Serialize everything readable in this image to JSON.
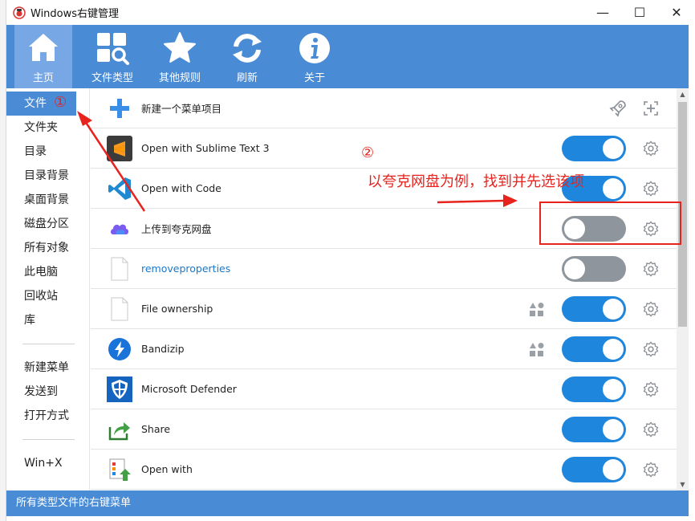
{
  "window": {
    "title": "Windows右键管理",
    "minimize_glyph": "—",
    "maximize_glyph": "☐",
    "close_glyph": "✕"
  },
  "toolbar": {
    "items": [
      {
        "label": "主页",
        "icon": "home-icon"
      },
      {
        "label": "文件类型",
        "icon": "file-types-icon"
      },
      {
        "label": "其他规则",
        "icon": "star-icon"
      },
      {
        "label": "刷新",
        "icon": "refresh-icon"
      },
      {
        "label": "关于",
        "icon": "info-icon"
      }
    ]
  },
  "sidebar": {
    "group1": [
      "文件",
      "文件夹",
      "目录",
      "目录背景",
      "桌面背景",
      "磁盘分区",
      "所有对象",
      "此电脑",
      "回收站",
      "库"
    ],
    "group2": [
      "新建菜单",
      "发送到",
      "打开方式"
    ],
    "group3": [
      "Win+X"
    ],
    "selected": "文件"
  },
  "list": {
    "rows": [
      {
        "label": "新建一个菜单项目",
        "icon": "add-item-icon",
        "type": "new"
      },
      {
        "label": "Open with Sublime Text 3",
        "icon": "sublime-icon",
        "toggle": "on"
      },
      {
        "label": "Open with Code",
        "icon": "vscode-icon",
        "toggle": "on"
      },
      {
        "label": "上传到夸克网盘",
        "icon": "quark-cloud-icon",
        "toggle": "off"
      },
      {
        "label": "removeproperties",
        "icon": "blank-file-icon",
        "toggle": "off",
        "link": true
      },
      {
        "label": "File ownership",
        "icon": "blank-file-icon",
        "toggle": "on",
        "extra": "shapes-icon"
      },
      {
        "label": "Bandizip",
        "icon": "bandizip-icon",
        "toggle": "on",
        "extra": "shapes-icon"
      },
      {
        "label": "Microsoft Defender",
        "icon": "defender-icon",
        "toggle": "on"
      },
      {
        "label": "Share",
        "icon": "share-icon",
        "toggle": "on"
      },
      {
        "label": "Open with",
        "icon": "open-with-icon",
        "toggle": "on"
      }
    ]
  },
  "statusbar": {
    "text": "所有类型文件的右键菜单"
  },
  "annotations": {
    "marker1": "①",
    "marker2": "②",
    "instruction": "以夸克网盘为例，找到并先选该项"
  },
  "colors": {
    "accent": "#4a8bd6",
    "toggle_on": "#1e86dc",
    "toggle_off": "#8f959c",
    "annotation": "#e8231e"
  }
}
